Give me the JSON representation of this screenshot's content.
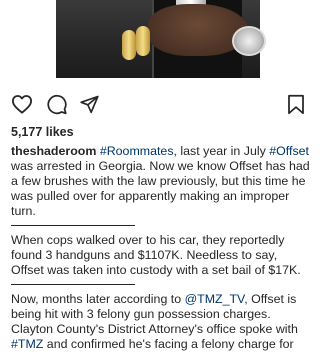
{
  "post": {
    "image_alt": "photo of a hand with jewelry and a watch",
    "likes": "5,177 likes",
    "username": "theshaderoom",
    "p1": {
      "tag1": "#Roommates",
      "t1": ", last year in July",
      "tag2": "#Offset",
      "t2": " was arrested in Georgia. Now we know Offset has had a few brushes with the law previously, but this time he was pulled over for apparently making an improper turn."
    },
    "p2": "When cops walked over to his car, they reportedly found 3 handguns and $1107K. Needless to say, Offset was taken into custody with a set bail of $17K.",
    "p3": {
      "t1": "Now, months later according to ",
      "mention": "@TMZ_TV",
      "t2": ", Offset is being hit with 3 felony gun possession charges. Clayton County's District Attorney's office spoke with ",
      "tag": "#TMZ",
      "t3": " and confirmed he's facing a felony charge for"
    }
  },
  "icons": {
    "like": "heart-icon",
    "comment": "comment-icon",
    "share": "share-icon",
    "save": "bookmark-icon"
  }
}
